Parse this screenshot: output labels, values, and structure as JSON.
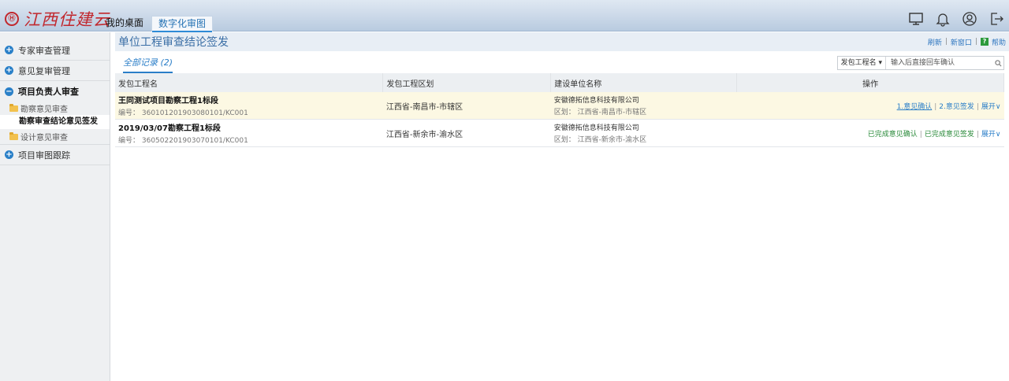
{
  "app": {
    "logo_mark": "Ⓗ",
    "logo_text": "江西住建云",
    "brand_color": "#c1272d"
  },
  "topnav": {
    "items": [
      {
        "label": "我的桌面",
        "active": false
      },
      {
        "label": "数字化审图",
        "active": true
      }
    ]
  },
  "top_icons": [
    "monitor-icon",
    "bell-icon",
    "user-icon",
    "logout-icon"
  ],
  "sidebar": {
    "groups": [
      {
        "label": "专家审查管理",
        "icon": "plus-circle-icon",
        "open": false
      },
      {
        "label": "意见复审管理",
        "icon": "plus-circle-icon",
        "open": false
      },
      {
        "label": "项目负责人审查",
        "icon": "minus-circle-icon",
        "open": true,
        "children": [
          {
            "label": "勘察意见审查",
            "icon": "folder-icon"
          },
          {
            "label": "勘察审查结论意见签发",
            "selected": true
          },
          {
            "label": "设计意见审查",
            "icon": "folder-icon"
          }
        ]
      },
      {
        "label": "项目审图跟踪",
        "icon": "plus-circle-icon",
        "open": false
      }
    ]
  },
  "page": {
    "title": "单位工程审查结论签发",
    "links": {
      "refresh": "刷新",
      "new_window": "新窗口",
      "help": "帮助",
      "help_icon": "?"
    },
    "tab_all": "全部记录 (2)",
    "search": {
      "field": "发包工程名 ▾",
      "placeholder": "输入后直接回车确认"
    }
  },
  "table": {
    "columns": [
      "发包工程名",
      "发包工程区划",
      "建设单位名称",
      "操作"
    ],
    "rows": [
      {
        "name": "王同测试项目勘察工程1标段",
        "code": "编号： 360101201903080101/KC001",
        "region": "江西省-南昌市-市辖区",
        "unit": "安徽德拓信息科技有限公司",
        "unit_area": "区划： 江西省-南昌市-市辖区",
        "ops": [
          "1.意见确认",
          "2.意见签发"
        ],
        "expand": "展开∨",
        "highlight": true
      },
      {
        "name": "2019/03/07勘察工程1标段",
        "code": "编号： 360502201903070101/KC001",
        "region": "江西省-新余市-渝水区",
        "unit": "安徽德拓信息科技有限公司",
        "unit_area": "区划： 江西省-新余市-渝水区",
        "ops": [
          "已完成意见确认",
          "已完成意见签发"
        ],
        "expand": "展开∨",
        "highlight": false
      }
    ]
  }
}
